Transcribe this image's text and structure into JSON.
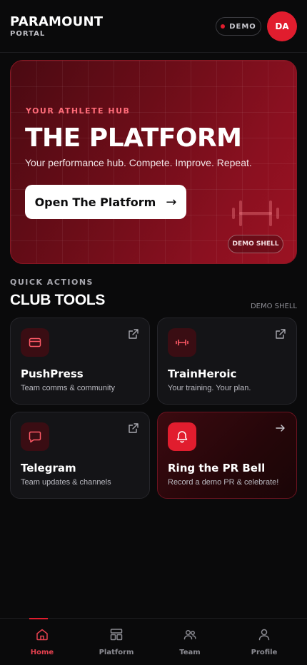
{
  "header": {
    "brand_title": "PARAMOUNT",
    "brand_subtitle": "PORTAL",
    "demo_badge": "DEMO",
    "avatar_initials": "DA"
  },
  "hero": {
    "eyebrow": "YOUR ATHLETE HUB",
    "title": "THE PLATFORM",
    "description": "Your performance hub. Compete. Improve. Repeat.",
    "button_label": "Open The Platform",
    "button_arrow": "→",
    "badge": "DEMO SHELL",
    "decor_icon": "dumbbell-icon"
  },
  "quick_actions": {
    "label": "QUICK ACTIONS",
    "title": "CLUB TOOLS",
    "meta": "DEMO SHELL",
    "cards": [
      {
        "title": "PushPress",
        "subtitle": "Team comms & community",
        "icon": "card-icon",
        "action_icon": "external-link-icon"
      },
      {
        "title": "TrainHeroic",
        "subtitle": "Your training. Your plan.",
        "icon": "dumbbell-icon",
        "action_icon": "external-link-icon"
      },
      {
        "title": "Telegram",
        "subtitle": "Team updates & channels",
        "icon": "chat-icon",
        "action_icon": "external-link-icon"
      },
      {
        "title": "Ring the PR Bell",
        "subtitle": "Record a demo PR & celebrate!",
        "icon": "bell-icon",
        "action_icon": "arrow-right-icon"
      }
    ]
  },
  "tabbar": {
    "active": "Home",
    "tabs": [
      {
        "label": "Home",
        "icon": "home-icon"
      },
      {
        "label": "Platform",
        "icon": "layout-icon"
      },
      {
        "label": "Team",
        "icon": "team-icon"
      },
      {
        "label": "Profile",
        "icon": "user-icon"
      }
    ]
  },
  "colors": {
    "accent": "#e11d2e",
    "background": "#0a0a0b",
    "card": "#141417"
  }
}
